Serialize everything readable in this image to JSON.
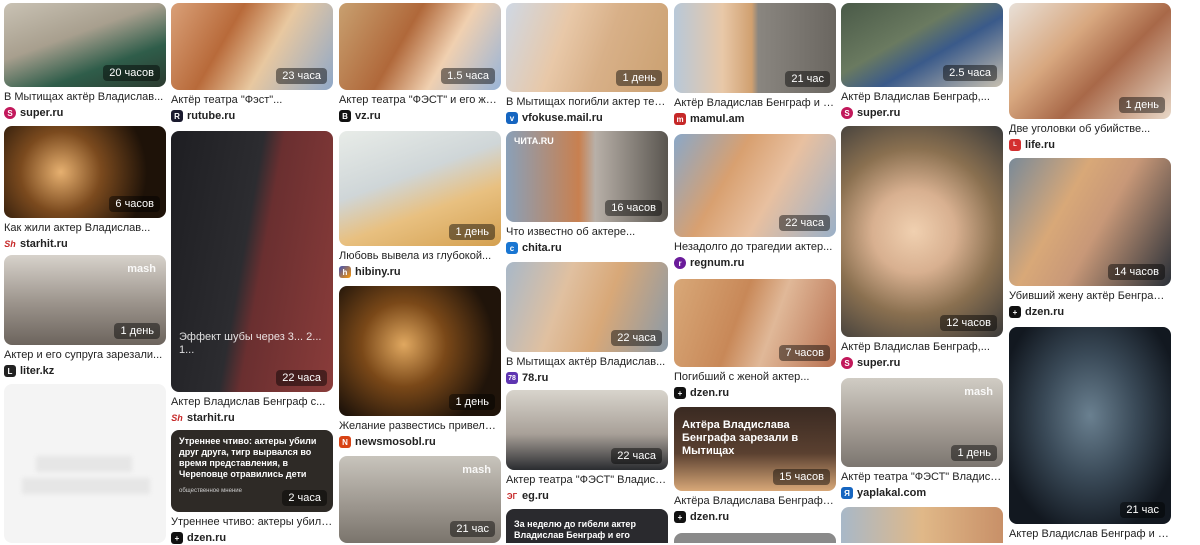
{
  "cards": [
    {
      "time": "20 часов",
      "title": "В Мытищах актёр Владислав...",
      "source": "super.ru",
      "fav_color": "#c2185b",
      "fav_glyph": "S"
    },
    {
      "time": "",
      "title": "Как жили актер Владислав...",
      "source": "starhit.ru",
      "fav_color": "#c62828",
      "fav_glyph": "Sh"
    },
    {
      "time": "1 день",
      "title": "Актер и его супруга зарезали...",
      "source": "liter.kz",
      "fav_color": "#222222",
      "fav_glyph": "L"
    },
    {
      "time": "23 часа",
      "title": "Актёр театра \"Фэст\"...",
      "source": "rutube.ru",
      "fav_color": "#1a1a2e",
      "fav_glyph": "R"
    },
    {
      "time": "22 часа",
      "title": "Актер Владислав Бенграф с...",
      "source": "starhit.ru",
      "fav_color": "#c62828",
      "fav_glyph": "Sh",
      "overlay": "Эффект шубы через 3... 2... 1..."
    },
    {
      "time": "2 часа",
      "title": "Утреннее чтиво: актеры убили...",
      "source": "dzen.ru",
      "fav_color": "#111111",
      "fav_glyph": "+",
      "overlay": "Утреннее чтиво: актеры убили друг друга, тигр вырвался во время представления, в Череповце отравились дети",
      "overlay_sub": "общественное мнение"
    },
    {
      "time": "1.5 часа",
      "title": "Актер театра \"ФЭСТ\" и его жена...",
      "source": "vz.ru",
      "fav_color": "#111111",
      "fav_glyph": "B"
    },
    {
      "time": "1 день",
      "title": "Любовь вывела из глубокой...",
      "source": "hibiny.ru",
      "fav_color": "#3f51b5",
      "fav_glyph": "h"
    },
    {
      "time": "1 день",
      "title": "Желание развестись привело к...",
      "source": "newsmosobl.ru",
      "fav_color": "#d84315",
      "fav_glyph": "N"
    },
    {
      "time": "21 час",
      "title": "",
      "source": "",
      "fav_color": "#000",
      "fav_glyph": ""
    },
    {
      "time": "1 день",
      "title": "В Мытищах погибли актер театр...",
      "source": "vfokuse.mail.ru",
      "fav_color": "#1565c0",
      "fav_glyph": "v"
    },
    {
      "time": "16 часов",
      "title": "Что известно об актере...",
      "source": "chita.ru",
      "fav_color": "#1976d2",
      "fav_glyph": "c",
      "logo": "ЧИТА.RU"
    },
    {
      "time": "22 часа",
      "title": "В Мытищах актёр Владислав...",
      "source": "78.ru",
      "fav_color": "#5e35b1",
      "fav_glyph": "78"
    },
    {
      "time": "22 часа",
      "title": "Актер театра \"ФЭСТ\" Владислав...",
      "source": "eg.ru",
      "fav_color": "#c62828",
      "fav_glyph": "ЭГ"
    },
    {
      "time": "",
      "title": "",
      "source": "",
      "fav_color": "#000",
      "fav_glyph": "",
      "overlay": "За неделю до гибели актер Владислав Бенграф и его"
    },
    {
      "time": "21 час",
      "title": "Актёр Владислав Бенграф и его...",
      "source": "mamul.am",
      "fav_color": "#c62828",
      "fav_glyph": "m"
    },
    {
      "time": "22 часа",
      "title": "Незадолго до трагедии актер...",
      "source": "regnum.ru",
      "fav_color": "#6a1b9a",
      "fav_glyph": "r"
    },
    {
      "time": "7 часов",
      "title": "Погибший с женой актер...",
      "source": "dzen.ru",
      "fav_color": "#111111",
      "fav_glyph": "+"
    },
    {
      "time": "15 часов",
      "title": "Актёра Владислава Бенграфа...",
      "source": "dzen.ru",
      "fav_color": "#111111",
      "fav_glyph": "+",
      "overlay": "Актёра Владислава Бенграфа зарезали в Мытищах"
    },
    {
      "time": "2.5 часа",
      "title": "Актёр Владислав Бенграф,...",
      "source": "super.ru",
      "fav_color": "#c2185b",
      "fav_glyph": "S"
    },
    {
      "time": "12 часов",
      "title": "Актёр Владислав Бенграф,...",
      "source": "super.ru",
      "fav_color": "#c2185b",
      "fav_glyph": "S"
    },
    {
      "time": "1 день",
      "title": "Актёр театра \"ФЭСТ\" Владислав...",
      "source": "yaplakal.com",
      "fav_color": "#1565c0",
      "fav_glyph": "Я"
    },
    {
      "time": "1 день",
      "title": "Две уголовки об убийстве...",
      "source": "life.ru",
      "fav_color": "#d32f2f",
      "fav_glyph": "L"
    },
    {
      "time": "14 часов",
      "title": "Убивший жену актёр Бенграф...",
      "source": "dzen.ru",
      "fav_color": "#111111",
      "fav_glyph": "+"
    },
    {
      "time": "21 час",
      "title": "Актер Владислав Бенграф и его...",
      "source": "",
      "fav_color": "#000",
      "fav_glyph": ""
    }
  ],
  "timestamps_extra": {
    "starhit_small": "6 часов",
    "mash_label": "mash"
  }
}
